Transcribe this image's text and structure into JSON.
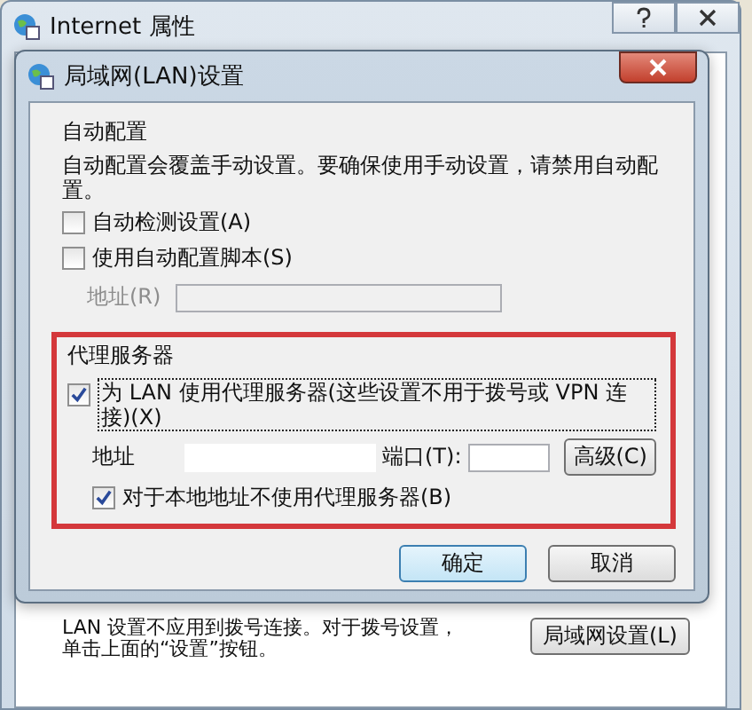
{
  "window": {
    "title": "Internet 属性"
  },
  "dialog": {
    "title": "局域网(LAN)设置",
    "auto_config": {
      "heading": "自动配置",
      "description": "自动配置会覆盖手动设置。要确保使用手动设置，请禁用自动配置。",
      "options": [
        {
          "label": "自动检测设置(A)",
          "checked": false
        },
        {
          "label": "使用自动配置脚本(S)",
          "checked": false
        }
      ],
      "address": {
        "label": "地址(R)",
        "disabled": true
      }
    },
    "proxy": {
      "heading": "代理服务器",
      "use_proxy": {
        "label": "为 LAN 使用代理服务器(这些设置不用于拨号或 VPN 连接)(X)",
        "checked": true,
        "focused": true
      },
      "address_label": "地址",
      "port_label": "端口(T):",
      "advanced_button": "高级(C)",
      "bypass_local": {
        "label": "对于本地地址不使用代理服务器(B)",
        "checked": true
      }
    },
    "buttons": [
      {
        "label": "确定",
        "default": true
      },
      {
        "label": "取消",
        "default": false
      }
    ]
  },
  "lan_note": "LAN 设置不应用到拨号连接。对于拨号设置，单击上面的“设置”按钮。",
  "lan_settings_button": "局域网设置(L)"
}
